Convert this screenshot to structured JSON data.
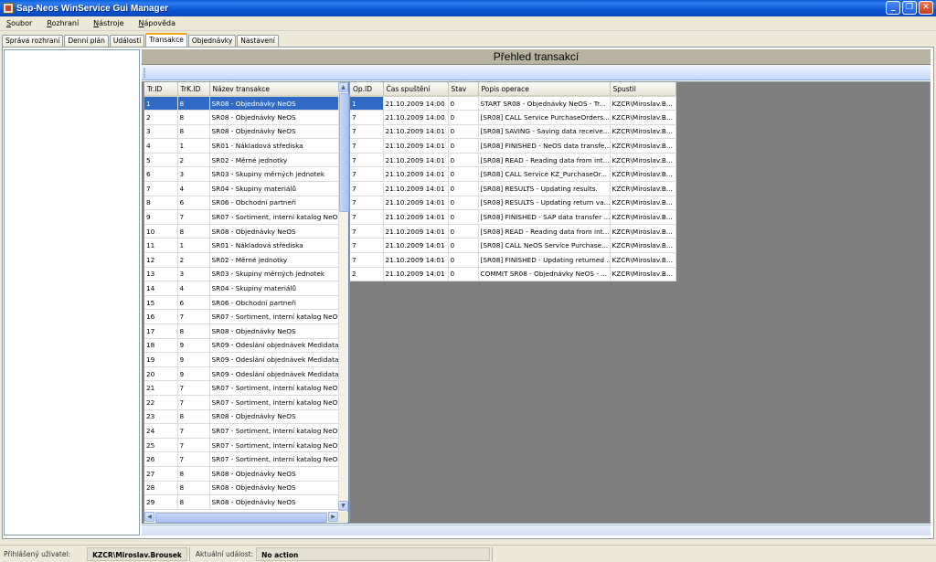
{
  "window": {
    "title": "Sap-Neos WinService Gui Manager"
  },
  "menu": [
    {
      "u": "S",
      "rest": "oubor"
    },
    {
      "u": "R",
      "rest": "ozhraní"
    },
    {
      "u": "N",
      "rest": "ástroje"
    },
    {
      "u": "N",
      "rest": "ápověda"
    }
  ],
  "tabs": [
    "Správa rozhraní",
    "Denní plán",
    "Události",
    "Transakce",
    "Objednávky",
    "Nastavení"
  ],
  "active_tab": "Transakce",
  "header": {
    "title": "Přehled transakcí"
  },
  "left_grid": {
    "columns": [
      "Tr.ID",
      "TrK.ID",
      "Název transakce"
    ],
    "rows": [
      [
        "1",
        "8",
        "SR08 - Objednávky NeOS"
      ],
      [
        "2",
        "8",
        "SR08 - Objednávky NeOS"
      ],
      [
        "3",
        "8",
        "SR08 - Objednávky NeOS"
      ],
      [
        "4",
        "1",
        "SR01 - Nákladová střediska"
      ],
      [
        "5",
        "2",
        "SR02 - Měrné jednotky"
      ],
      [
        "6",
        "3",
        "SR03 - Skupiny měrných jednotek"
      ],
      [
        "7",
        "4",
        "SR04 - Skupiny materiálů"
      ],
      [
        "8",
        "6",
        "SR06 - Obchodní partneři"
      ],
      [
        "9",
        "7",
        "SR07 - Sortiment, interní katalog NeOS"
      ],
      [
        "10",
        "8",
        "SR08 - Objednávky NeOS"
      ],
      [
        "11",
        "1",
        "SR01 - Nákladová střediska"
      ],
      [
        "12",
        "2",
        "SR02 - Měrné jednotky"
      ],
      [
        "13",
        "3",
        "SR03 - Skupiny měrných jednotek"
      ],
      [
        "14",
        "4",
        "SR04 - Skupiny materiálů"
      ],
      [
        "15",
        "6",
        "SR06 - Obchodní partneři"
      ],
      [
        "16",
        "7",
        "SR07 - Sortiment, interní katalog NeOS"
      ],
      [
        "17",
        "8",
        "SR08 - Objednávky NeOS"
      ],
      [
        "18",
        "9",
        "SR09 - Odeslání objednávek Medidata"
      ],
      [
        "19",
        "9",
        "SR09 - Odeslání objednávek Medidata"
      ],
      [
        "20",
        "9",
        "SR09 - Odeslání objednávek Medidata"
      ],
      [
        "21",
        "7",
        "SR07 - Sortiment, interní katalog NeOS"
      ],
      [
        "22",
        "7",
        "SR07 - Sortiment, interní katalog NeOS"
      ],
      [
        "23",
        "8",
        "SR08 - Objednávky NeOS"
      ],
      [
        "24",
        "7",
        "SR07 - Sortiment, interní katalog NeOS"
      ],
      [
        "25",
        "7",
        "SR07 - Sortiment, interní katalog NeOS"
      ],
      [
        "26",
        "7",
        "SR07 - Sortiment, interní katalog NeOS"
      ],
      [
        "27",
        "8",
        "SR08 - Objednávky NeOS"
      ],
      [
        "28",
        "8",
        "SR08 - Objednávky NeOS"
      ],
      [
        "29",
        "8",
        "SR08 - Objednávky NeOS"
      ]
    ]
  },
  "right_grid": {
    "columns": [
      "Op.ID",
      "Čas spuštění",
      "Stav",
      "Popis operace",
      "Spustil"
    ],
    "rows": [
      [
        "1",
        "21.10.2009 14:00",
        "0",
        "START SR08 - Objednávky NeOS - Tr...",
        "KZCR\\Miroslav.B..."
      ],
      [
        "7",
        "21.10.2009 14:00",
        "0",
        "[SR08] CALL Service PurchaseOrders...",
        "KZCR\\Miroslav.B..."
      ],
      [
        "7",
        "21.10.2009 14:01",
        "0",
        "[SR08] SAVING - Saving data receive...",
        "KZCR\\Miroslav.B..."
      ],
      [
        "7",
        "21.10.2009 14:01",
        "0",
        "[SR08] FINISHED - NeOS data transfe...",
        "KZCR\\Miroslav.B..."
      ],
      [
        "7",
        "21.10.2009 14:01",
        "0",
        "[SR08] READ - Reading data from int...",
        "KZCR\\Miroslav.B..."
      ],
      [
        "7",
        "21.10.2009 14:01",
        "0",
        "[SR08] CALL Service KZ_PurchaseOr...",
        "KZCR\\Miroslav.B..."
      ],
      [
        "7",
        "21.10.2009 14:01",
        "0",
        "[SR08] RESULTS - Updating results.",
        "KZCR\\Miroslav.B..."
      ],
      [
        "7",
        "21.10.2009 14:01",
        "0",
        "[SR08] RESULTS - Updating return va...",
        "KZCR\\Miroslav.B..."
      ],
      [
        "7",
        "21.10.2009 14:01",
        "0",
        "[SR08] FINISHED - SAP data transfer ...",
        "KZCR\\Miroslav.B..."
      ],
      [
        "7",
        "21.10.2009 14:01",
        "0",
        "[SR08] READ - Reading data from int...",
        "KZCR\\Miroslav.B..."
      ],
      [
        "7",
        "21.10.2009 14:01",
        "0",
        "[SR08] CALL NeOS Service Purchase...",
        "KZCR\\Miroslav.B..."
      ],
      [
        "7",
        "21.10.2009 14:01",
        "0",
        "[SR08] FINISHED - Updating returned ...",
        "KZCR\\Miroslav.B..."
      ],
      [
        "2",
        "21.10.2009 14:01",
        "0",
        "COMMIT SR08 - Objednávky NeOS - ...",
        "KZCR\\Miroslav.B..."
      ]
    ]
  },
  "status": {
    "user_label": "Přihlášený uživatel:",
    "user_value": "KZCR\\Miroslav.Brousek",
    "event_label": "Aktuální událost:",
    "event_value": "No action"
  },
  "colors": {
    "selection": "#316ac5",
    "titlebar": "#0b56d4",
    "grid_bg": "#7f7f7f"
  }
}
